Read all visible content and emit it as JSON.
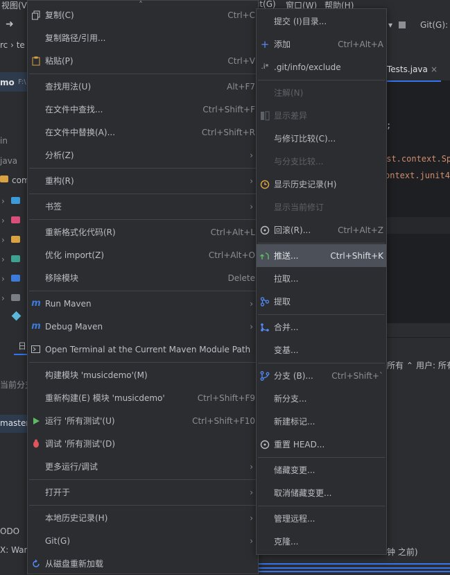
{
  "background": {
    "menu_view": "视图(V)",
    "menu_git": "it(G)",
    "menu_window": "窗口(W)",
    "menu_help": "帮助(H)",
    "git_toolbar": "Git(G):",
    "breadcrumb": "rc ›  te",
    "project_name": "mo",
    "project_path": "F:\\",
    "tree_bin": "in",
    "tree_java": "java",
    "tree_com": "com",
    "tab_label": "Tests.java",
    "code_line1": ";",
    "code_line2": "est.context.Sp",
    "code_line3": "ontext.junit4",
    "bottom_tab": "日",
    "current_branch_label": "当前分支",
    "branch": "master",
    "filter_all": "所有 ⌃",
    "filter_user": "用户: 所有",
    "todo": "ODO",
    "war": "X: War",
    "minutes_ago": "钟 之前)"
  },
  "context_menu": {
    "items": [
      {
        "label": "复制(C)",
        "shortcut": "Ctrl+C"
      },
      {
        "label": "复制路径/引用..."
      },
      {
        "label": "粘贴(P)",
        "shortcut": "Ctrl+V"
      },
      {
        "label": "查找用法(U)",
        "shortcut": "Alt+F7"
      },
      {
        "label": "在文件中查找...",
        "shortcut": "Ctrl+Shift+F"
      },
      {
        "label": "在文件中替换(A)...",
        "shortcut": "Ctrl+Shift+R"
      },
      {
        "label": "分析(Z)"
      },
      {
        "label": "重构(R)"
      },
      {
        "label": "书签"
      },
      {
        "label": "重新格式化代码(R)",
        "shortcut": "Ctrl+Alt+L"
      },
      {
        "label": "优化 import(Z)",
        "shortcut": "Ctrl+Alt+O"
      },
      {
        "label": "移除模块",
        "shortcut": "Delete"
      },
      {
        "label": "Run Maven"
      },
      {
        "label": "Debug Maven"
      },
      {
        "label": "Open Terminal at the Current Maven Module Path"
      },
      {
        "label": "构建模块 'musicdemo'(M)"
      },
      {
        "label": "重新构建(E) 模块 'musicdemo'",
        "shortcut": "Ctrl+Shift+F9"
      },
      {
        "label": "运行 '所有测试'(U)",
        "shortcut": "Ctrl+Shift+F10"
      },
      {
        "label": "调试 '所有测试'(D)"
      },
      {
        "label": "更多运行/调试"
      },
      {
        "label": "打开于"
      },
      {
        "label": "本地历史记录(H)"
      },
      {
        "label": "Git(G)"
      },
      {
        "label": "从磁盘重新加载"
      }
    ]
  },
  "git_submenu": {
    "items": [
      {
        "label": "提交 (I)目录..."
      },
      {
        "label": "添加",
        "shortcut": "Ctrl+Alt+A"
      },
      {
        "label": ".git/info/exclude"
      },
      {
        "label": "注解(N)"
      },
      {
        "label": "显示差异"
      },
      {
        "label": "与修订比较(C)..."
      },
      {
        "label": "与分支比较..."
      },
      {
        "label": "显示历史记录(H)"
      },
      {
        "label": "显示当前修订"
      },
      {
        "label": "回滚(R)...",
        "shortcut": "Ctrl+Alt+Z"
      },
      {
        "label": "推送...",
        "shortcut": "Ctrl+Shift+K"
      },
      {
        "label": "拉取..."
      },
      {
        "label": "提取"
      },
      {
        "label": "合并..."
      },
      {
        "label": "变基..."
      },
      {
        "label": "分支 (B)...",
        "shortcut": "Ctrl+Shift+`"
      },
      {
        "label": "新分支..."
      },
      {
        "label": "新建标记..."
      },
      {
        "label": "重置 HEAD..."
      },
      {
        "label": "储藏变更..."
      },
      {
        "label": "取消储藏变更..."
      },
      {
        "label": "管理远程..."
      },
      {
        "label": "克隆..."
      }
    ]
  },
  "colors": {
    "menu_bg": "#2b2d30",
    "selection": "#4b5059",
    "accent": "#548af7",
    "maven_icon": "#3d7bd9",
    "run_green": "#5fb865",
    "debug_red": "#e0555b"
  }
}
